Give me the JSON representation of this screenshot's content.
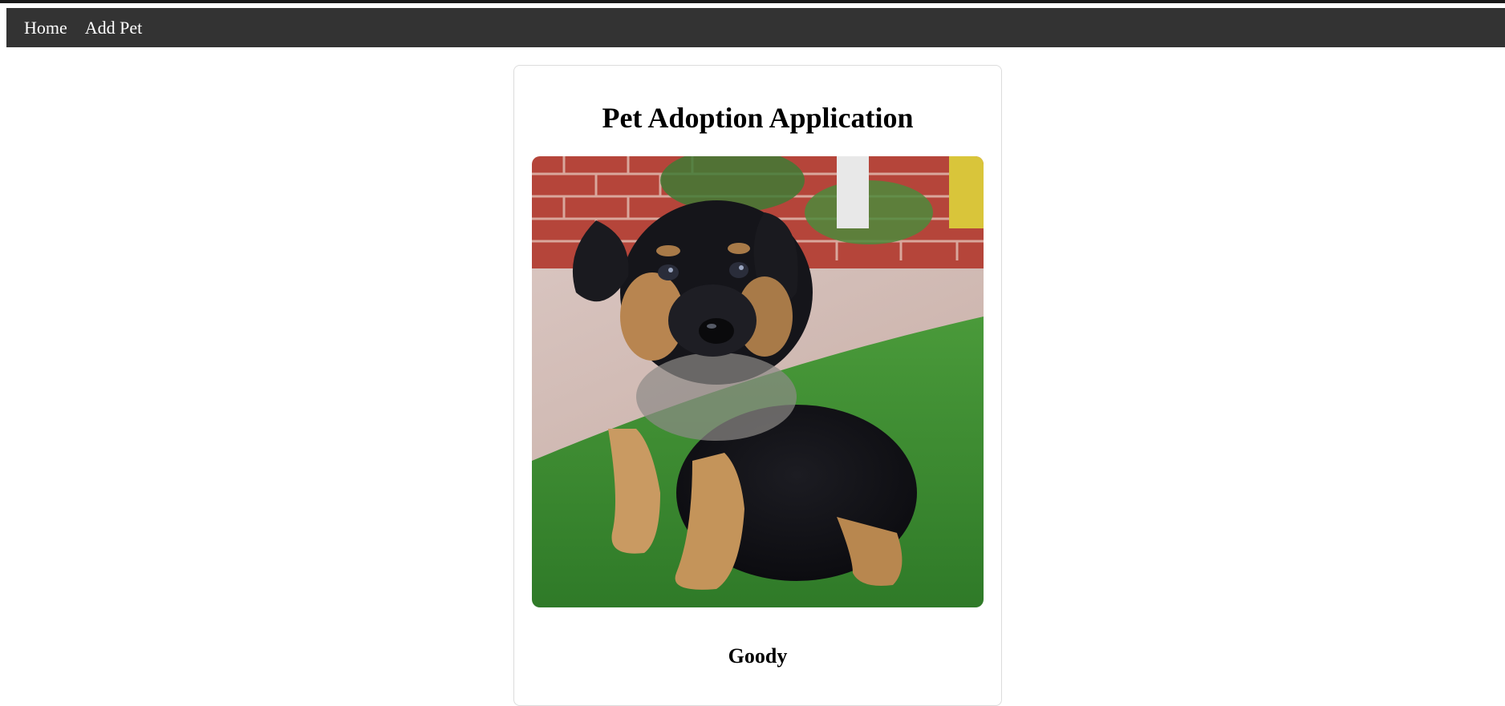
{
  "navbar": {
    "links": [
      {
        "label": "Home"
      },
      {
        "label": "Add Pet"
      }
    ],
    "background": "#333333"
  },
  "page": {
    "title": "Pet Adoption Application"
  },
  "pet": {
    "name": "Goody",
    "photo_subject": "german-shepherd-puppy-on-grass"
  }
}
